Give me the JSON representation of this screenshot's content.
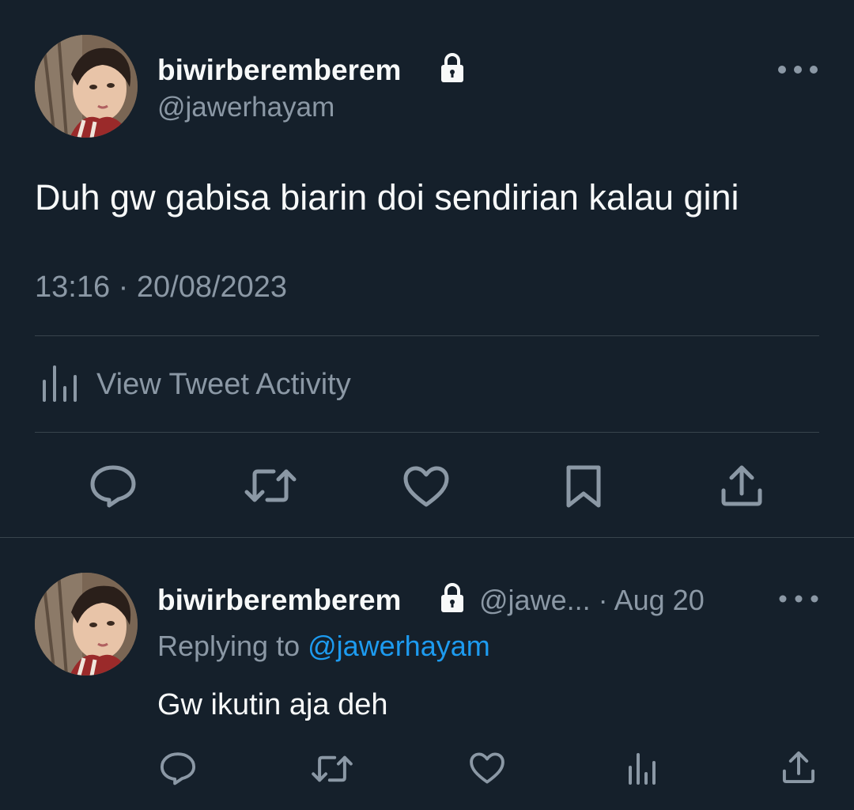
{
  "main_tweet": {
    "display_name": "biwirberemberem",
    "handle": "@jawerhayam",
    "text": "Duh gw gabisa biarin doi sendirian kalau gini",
    "time": "13:16",
    "separator": " · ",
    "date": "20/08/2023",
    "activity_label": "View Tweet Activity",
    "icons": {
      "lock": "lock-icon",
      "more": "more-icon",
      "activity": "bar-chart-icon",
      "reply": "reply-icon",
      "retweet": "retweet-icon",
      "like": "heart-icon",
      "bookmark": "bookmark-icon",
      "share": "share-icon"
    }
  },
  "reply_tweet": {
    "display_name": "biwirberemberem",
    "handle": "@jawe...",
    "separator": " · ",
    "date": "Aug 20",
    "replying_prefix": "Replying to ",
    "replying_to": "@jawerhayam",
    "text": "Gw ikutin aja deh",
    "icons": {
      "reply": "reply-icon",
      "retweet": "retweet-icon",
      "like": "heart-icon",
      "views": "views-icon",
      "share": "share-icon"
    }
  },
  "colors": {
    "background": "#15202b",
    "primary_text": "#f7f9f9",
    "secondary_text": "#8b98a5",
    "link": "#1d9bf0",
    "divider": "#38444d"
  }
}
